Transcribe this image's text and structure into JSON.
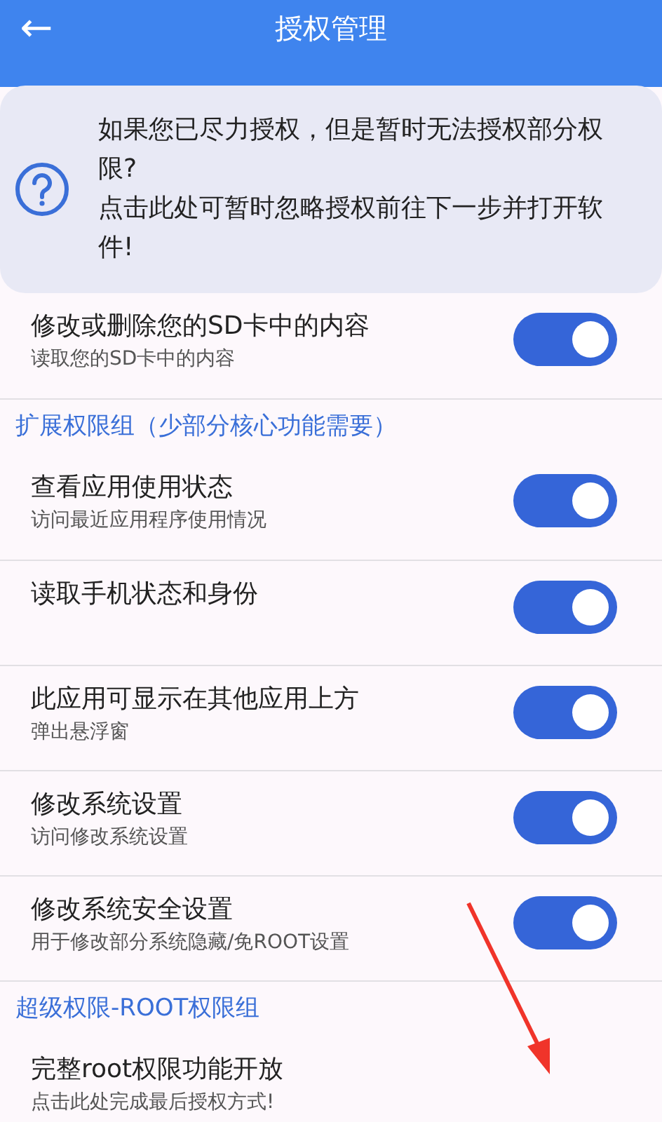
{
  "header": {
    "back": "←",
    "title": "授权管理"
  },
  "notice": {
    "lines": [
      "如果您已尽力授权，但是暂时无法授权部分权限?",
      "点击此处可暂时忽略授权前往下一步并打开软件!"
    ]
  },
  "rows": [
    {
      "kind": "permission",
      "title": "修改或删除您的SD卡中的内容",
      "subtitle": "读取您的SD卡中的内容",
      "on": true
    },
    {
      "kind": "header",
      "title": "扩展权限组（少部分核心功能需要）"
    },
    {
      "kind": "permission",
      "title": "查看应用使用状态",
      "subtitle": "访问最近应用程序使用情况",
      "on": true
    },
    {
      "kind": "permission",
      "title": "读取手机状态和身份",
      "on": true
    },
    {
      "kind": "permission",
      "title": "此应用可显示在其他应用上方",
      "subtitle": "弹出悬浮窗",
      "on": true
    },
    {
      "kind": "permission",
      "title": "修改系统设置",
      "subtitle": "访问修改系统设置",
      "on": true
    },
    {
      "kind": "permission",
      "title": "修改系统安全设置",
      "subtitle": "用于修改部分系统隐藏/免ROOT设置",
      "on": true
    },
    {
      "kind": "header",
      "title": "超级权限-ROOT权限组"
    },
    {
      "kind": "action",
      "title": "完整root权限功能开放",
      "subtitle": "点击此处完成最后授权方式!"
    }
  ]
}
